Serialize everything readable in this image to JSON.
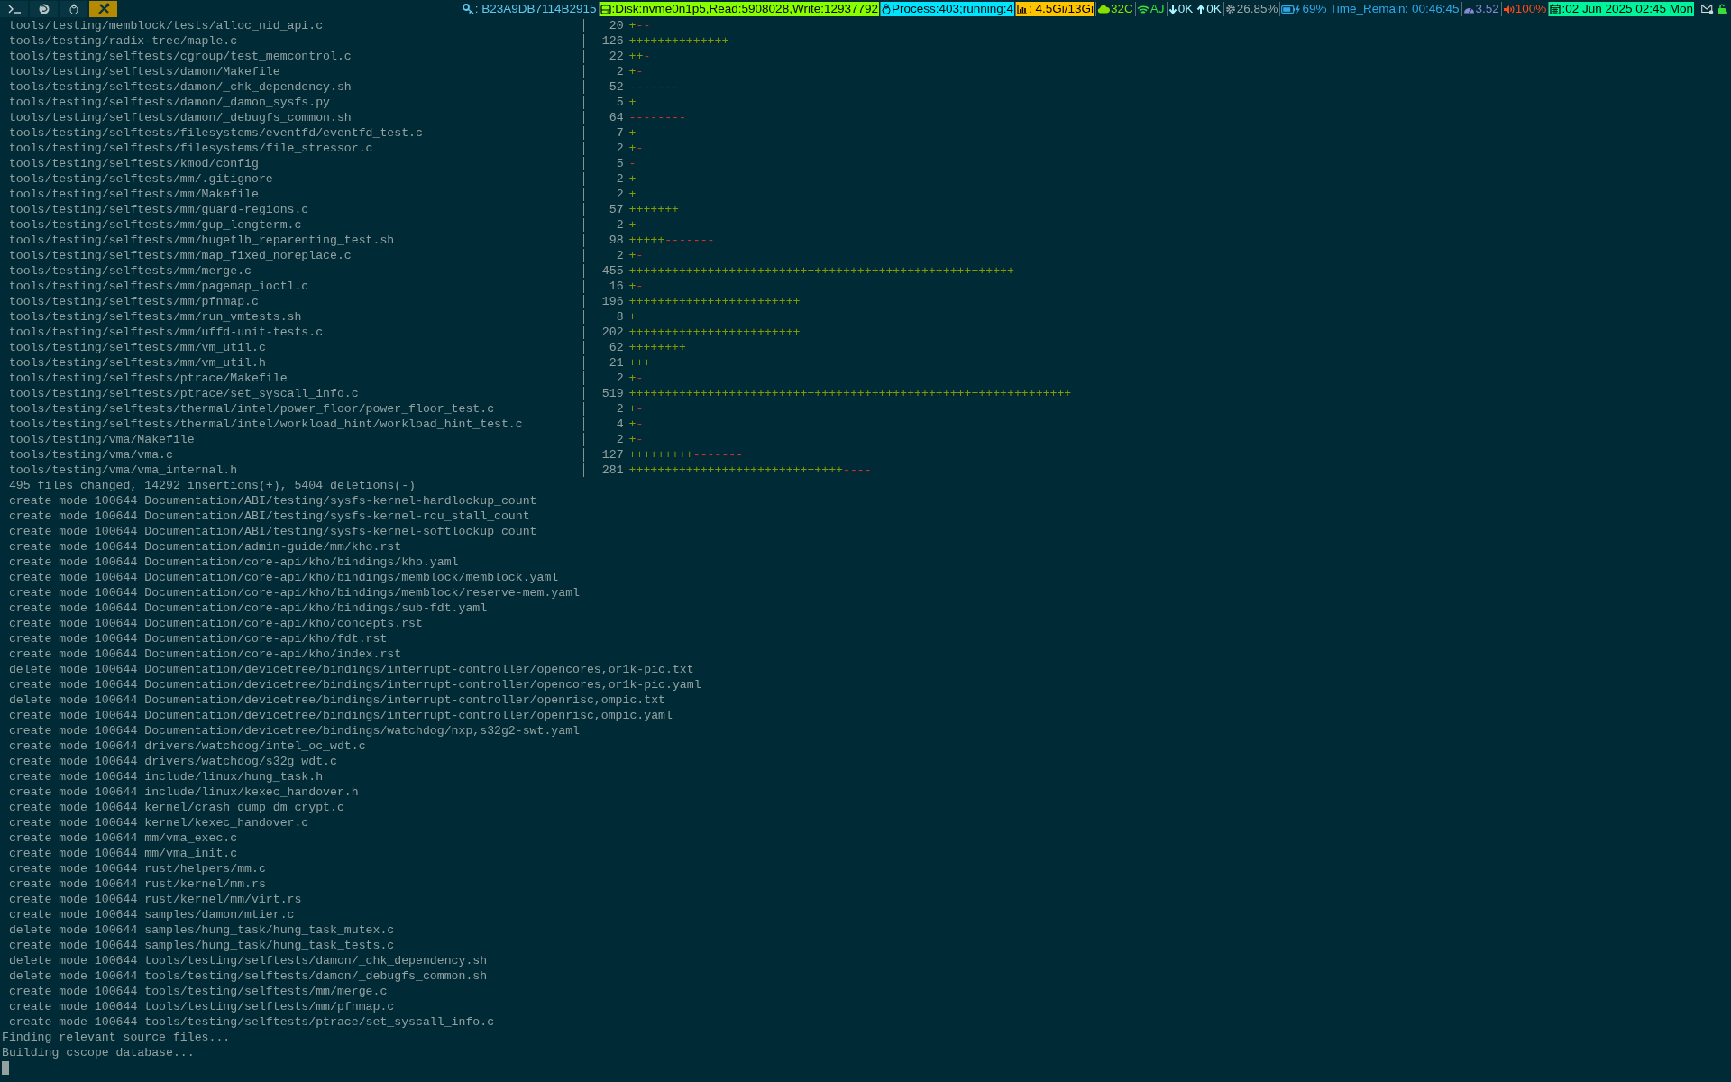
{
  "top_bar": {
    "workspaces": [
      {
        "selected": false
      },
      {
        "selected": false
      },
      {
        "selected": false
      },
      {
        "selected": true
      }
    ],
    "status_items": [
      {
        "kind": "text",
        "color": "#5fc8f0",
        "text": ": B23A9DB7114B2915"
      },
      {
        "kind": "badge",
        "color": "#87ff00",
        "text": ":Disk:nvme0n1p5,Read:5908028,Write:12937792"
      },
      {
        "kind": "badge",
        "color": "#00e5ff",
        "text": " Process:403;running:4"
      },
      {
        "kind": "badge",
        "color": "#ffc400",
        "text": " : 4.5Gi/13Gi"
      },
      {
        "kind": "text",
        "color": "#87e000",
        "text": "32C"
      },
      {
        "kind": "text",
        "color": "#3ddc3d",
        "text": "AJ"
      },
      {
        "kind": "text",
        "color": "#a8f4ff",
        "text": "0K"
      },
      {
        "kind": "text",
        "color": "#a8f4ff",
        "text": "0K"
      },
      {
        "kind": "text",
        "color": "#9aa5a8",
        "text": "26.85%"
      },
      {
        "kind": "text",
        "color": "#2ea8e8",
        "text": "69% Time_Remain: 00:46:45"
      },
      {
        "kind": "text",
        "color": "#8a86d8",
        "text": "3.52"
      },
      {
        "kind": "text",
        "color": "#ff4a1a",
        "text": "100%"
      },
      {
        "kind": "badge",
        "color": "#00f59b",
        "text": ":02 Jun 2025 02:45 Mon"
      }
    ]
  },
  "terminal": {
    "diffstat": [
      {
        "path": "tools/testing/memblock/tests/alloc_nid_api.c",
        "count": "20",
        "adds": "+",
        "dels": "--"
      },
      {
        "path": "tools/testing/radix-tree/maple.c",
        "count": "126",
        "adds": "++++++++++++++",
        "dels": "-"
      },
      {
        "path": "tools/testing/selftests/cgroup/test_memcontrol.c",
        "count": "22",
        "adds": "++",
        "dels": "-"
      },
      {
        "path": "tools/testing/selftests/damon/Makefile",
        "count": "2",
        "adds": "+",
        "dels": "-"
      },
      {
        "path": "tools/testing/selftests/damon/_chk_dependency.sh",
        "count": "52",
        "dels": "-------"
      },
      {
        "path": "tools/testing/selftests/damon/_damon_sysfs.py",
        "count": "5",
        "adds": "+"
      },
      {
        "path": "tools/testing/selftests/damon/_debugfs_common.sh",
        "count": "64",
        "dels": "--------"
      },
      {
        "path": "tools/testing/selftests/filesystems/eventfd/eventfd_test.c",
        "count": "7",
        "adds": "+",
        "dels": "-"
      },
      {
        "path": "tools/testing/selftests/filesystems/file_stressor.c",
        "count": "2",
        "adds": "+",
        "dels": "-"
      },
      {
        "path": "tools/testing/selftests/kmod/config",
        "count": "5",
        "dels": "-"
      },
      {
        "path": "tools/testing/selftests/mm/.gitignore",
        "count": "2",
        "adds": "+"
      },
      {
        "path": "tools/testing/selftests/mm/Makefile",
        "count": "2",
        "adds": "+"
      },
      {
        "path": "tools/testing/selftests/mm/guard-regions.c",
        "count": "57",
        "adds": "+++++++"
      },
      {
        "path": "tools/testing/selftests/mm/gup_longterm.c",
        "count": "2",
        "adds": "+",
        "dels": "-"
      },
      {
        "path": "tools/testing/selftests/mm/hugetlb_reparenting_test.sh",
        "count": "98",
        "adds": "+++++",
        "dels": "-------"
      },
      {
        "path": "tools/testing/selftests/mm/map_fixed_noreplace.c",
        "count": "2",
        "adds": "+",
        "dels": "-"
      },
      {
        "path": "tools/testing/selftests/mm/merge.c",
        "count": "455",
        "adds": "++++++++++++++++++++++++++++++++++++++++++++++++++++++"
      },
      {
        "path": "tools/testing/selftests/mm/pagemap_ioctl.c",
        "count": "16",
        "adds": "+",
        "dels": "-"
      },
      {
        "path": "tools/testing/selftests/mm/pfnmap.c",
        "count": "196",
        "adds": "++++++++++++++++++++++++"
      },
      {
        "path": "tools/testing/selftests/mm/run_vmtests.sh",
        "count": "8",
        "adds": "+"
      },
      {
        "path": "tools/testing/selftests/mm/uffd-unit-tests.c",
        "count": "202",
        "adds": "++++++++++++++++++++++++"
      },
      {
        "path": "tools/testing/selftests/mm/vm_util.c",
        "count": "62",
        "adds": "++++++++"
      },
      {
        "path": "tools/testing/selftests/mm/vm_util.h",
        "count": "21",
        "adds": "+++"
      },
      {
        "path": "tools/testing/selftests/ptrace/Makefile",
        "count": "2",
        "adds": "+",
        "dels": "-"
      },
      {
        "path": "tools/testing/selftests/ptrace/set_syscall_info.c",
        "count": "519",
        "adds": "++++++++++++++++++++++++++++++++++++++++++++++++++++++++++++++"
      },
      {
        "path": "tools/testing/selftests/thermal/intel/power_floor/power_floor_test.c",
        "count": "2",
        "adds": "+",
        "dels": "-"
      },
      {
        "path": "tools/testing/selftests/thermal/intel/workload_hint/workload_hint_test.c",
        "count": "4",
        "adds": "+",
        "dels": "-"
      },
      {
        "path": "tools/testing/vma/Makefile",
        "count": "2",
        "adds": "+",
        "dels": "-"
      },
      {
        "path": "tools/testing/vma/vma.c",
        "count": "127",
        "adds": "+++++++++",
        "dels": "-------"
      },
      {
        "path": "tools/testing/vma/vma_internal.h",
        "count": "281",
        "adds": "++++++++++++++++++++++++++++++",
        "dels": "----"
      }
    ],
    "summary": "495 files changed, 14292 insertions(+), 5404 deletions(-)",
    "mode_lines": [
      "create mode 100644 Documentation/ABI/testing/sysfs-kernel-hardlockup_count",
      "create mode 100644 Documentation/ABI/testing/sysfs-kernel-rcu_stall_count",
      "create mode 100644 Documentation/ABI/testing/sysfs-kernel-softlockup_count",
      "create mode 100644 Documentation/admin-guide/mm/kho.rst",
      "create mode 100644 Documentation/core-api/kho/bindings/kho.yaml",
      "create mode 100644 Documentation/core-api/kho/bindings/memblock/memblock.yaml",
      "create mode 100644 Documentation/core-api/kho/bindings/memblock/reserve-mem.yaml",
      "create mode 100644 Documentation/core-api/kho/bindings/sub-fdt.yaml",
      "create mode 100644 Documentation/core-api/kho/concepts.rst",
      "create mode 100644 Documentation/core-api/kho/fdt.rst",
      "create mode 100644 Documentation/core-api/kho/index.rst",
      "delete mode 100644 Documentation/devicetree/bindings/interrupt-controller/opencores,or1k-pic.txt",
      "create mode 100644 Documentation/devicetree/bindings/interrupt-controller/opencores,or1k-pic.yaml",
      "delete mode 100644 Documentation/devicetree/bindings/interrupt-controller/openrisc,ompic.txt",
      "create mode 100644 Documentation/devicetree/bindings/interrupt-controller/openrisc,ompic.yaml",
      "create mode 100644 Documentation/devicetree/bindings/watchdog/nxp,s32g2-swt.yaml",
      "create mode 100644 drivers/watchdog/intel_oc_wdt.c",
      "create mode 100644 drivers/watchdog/s32g_wdt.c",
      "create mode 100644 include/linux/hung_task.h",
      "create mode 100644 include/linux/kexec_handover.h",
      "create mode 100644 kernel/crash_dump_dm_crypt.c",
      "create mode 100644 kernel/kexec_handover.c",
      "create mode 100644 mm/vma_exec.c",
      "create mode 100644 mm/vma_init.c",
      "create mode 100644 rust/helpers/mm.c",
      "create mode 100644 rust/kernel/mm.rs",
      "create mode 100644 rust/kernel/mm/virt.rs",
      "create mode 100644 samples/damon/mtier.c",
      "delete mode 100644 samples/hung_task/hung_task_mutex.c",
      "create mode 100644 samples/hung_task/hung_task_tests.c",
      "delete mode 100644 tools/testing/selftests/damon/_chk_dependency.sh",
      "delete mode 100644 tools/testing/selftests/damon/_debugfs_common.sh",
      "create mode 100644 tools/testing/selftests/mm/merge.c",
      "create mode 100644 tools/testing/selftests/mm/pfnmap.c",
      "create mode 100644 tools/testing/selftests/ptrace/set_syscall_info.c"
    ],
    "output_lines": [
      "Finding relevant source files...",
      "Building cscope database..."
    ]
  }
}
